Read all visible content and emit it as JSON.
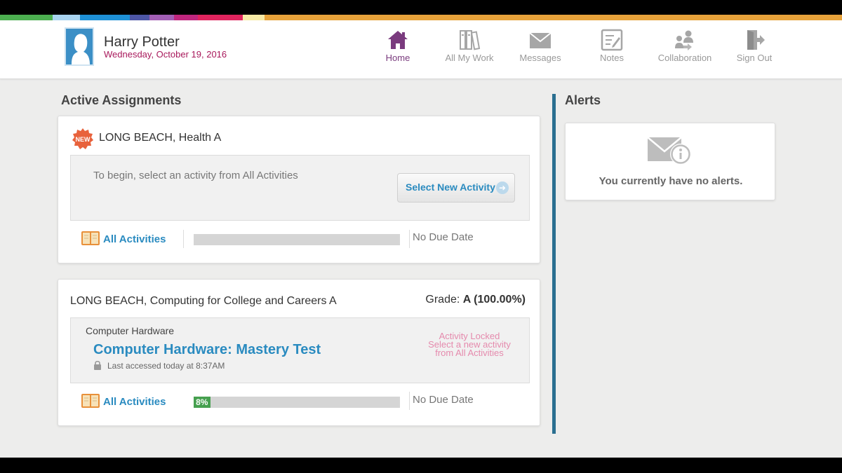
{
  "user": {
    "name": "Harry Potter",
    "date": "Wednesday, October 19, 2016"
  },
  "nav": [
    {
      "label": "Home",
      "icon": "home-icon",
      "active": true
    },
    {
      "label": "All My Work",
      "icon": "books-icon",
      "active": false
    },
    {
      "label": "Messages",
      "icon": "envelope-icon",
      "active": false
    },
    {
      "label": "Notes",
      "icon": "notepad-icon",
      "active": false
    },
    {
      "label": "Collaboration",
      "icon": "people-icon",
      "active": false
    },
    {
      "label": "Sign Out",
      "icon": "exit-door-icon",
      "active": false
    }
  ],
  "colors": {
    "strip": [
      "#4caf50",
      "#a8d3ef",
      "#1e90d6",
      "#4d56a6",
      "#a25fb5",
      "#c0267e",
      "#e0245e",
      "#f6e9a5",
      "#e7a23a"
    ],
    "accent": "#2a8bc0",
    "date": "#a8185b",
    "home_active": "#7a3b7e",
    "progress_fill": "#46a04f",
    "locked": "#e58aad",
    "new_badge": "#e8623c"
  },
  "active_assignments": {
    "title": "Active Assignments",
    "cards": [
      {
        "badge": "NEW",
        "course": "LONG BEACH, Health A",
        "hint": "To begin, select an activity from All Activities",
        "button": "Select New Activity",
        "all_activities": "All Activities",
        "progress_percent": 0,
        "due": "No Due Date"
      },
      {
        "course": "LONG BEACH, Computing for College and Careers A",
        "grade_label": "Grade:",
        "grade_value": "A (100.00%)",
        "topic": "Computer Hardware",
        "activity": "Computer Hardware: Mastery Test",
        "last_accessed": "Last accessed today at 8:37AM",
        "locked_lines": [
          "Activity Locked",
          "Select a new activity",
          "from All Activities"
        ],
        "all_activities": "All Activities",
        "progress_percent": 8,
        "progress_label": "8%",
        "due": "No Due Date"
      }
    ]
  },
  "alerts": {
    "title": "Alerts",
    "message": "You currently have no alerts.",
    "icon": "envelope-info-icon"
  }
}
